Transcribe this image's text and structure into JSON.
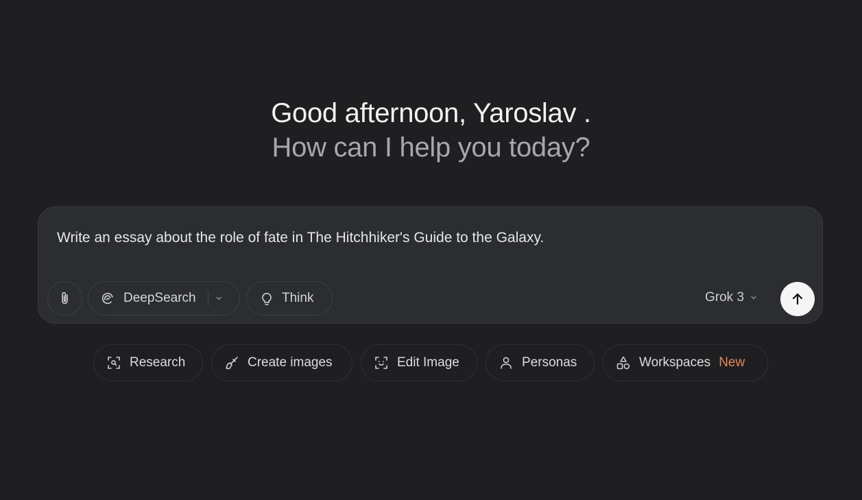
{
  "greeting": {
    "line1": "Good afternoon, Yaroslav .",
    "line2": "How can I help you today?"
  },
  "composer": {
    "prompt_text": "Write an essay about the role of fate in The Hitchhiker's Guide to the Galaxy.",
    "deepsearch_label": "DeepSearch",
    "think_label": "Think",
    "model_label": "Grok 3"
  },
  "suggestions": [
    {
      "label": "Research",
      "icon": "research-scan-icon"
    },
    {
      "label": "Create images",
      "icon": "paintbrush-icon"
    },
    {
      "label": "Edit Image",
      "icon": "face-scan-icon"
    },
    {
      "label": "Personas",
      "icon": "person-icon"
    },
    {
      "label": "Workspaces",
      "icon": "shapes-icon",
      "badge": "New"
    }
  ],
  "colors": {
    "background": "#1f1f21",
    "composer": "#2c2d30",
    "new_badge": "#e0875a",
    "send_button": "#f5f5f5"
  }
}
